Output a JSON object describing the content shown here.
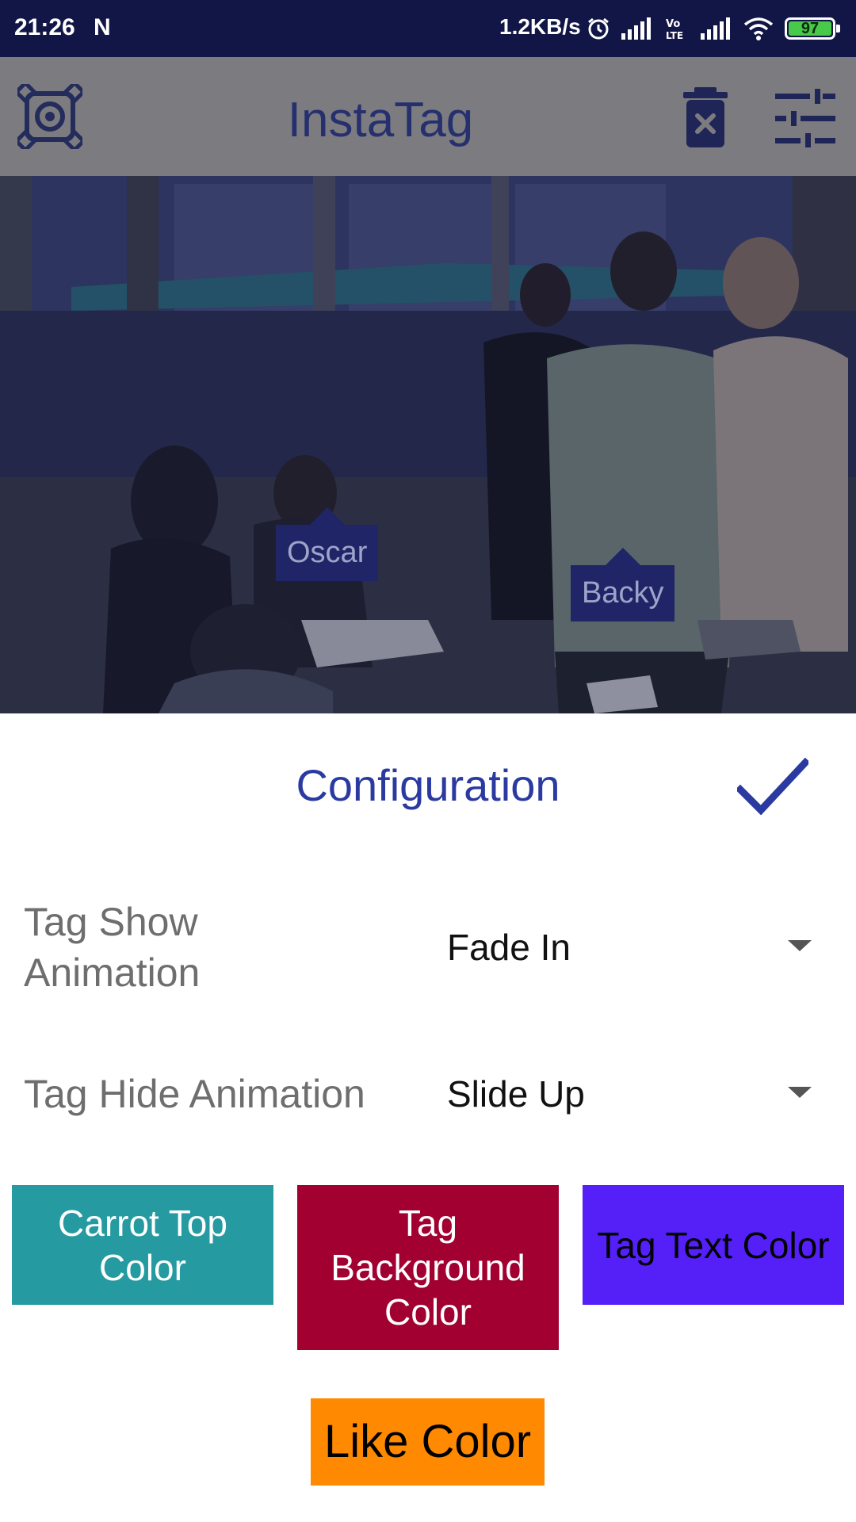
{
  "status_bar": {
    "time": "21:26",
    "carrier_glyph": "N",
    "speed": "1.2KB/s",
    "battery": "97",
    "icons": [
      "alarm-icon",
      "signal-icon",
      "volte-icon",
      "signal-icon",
      "wifi-icon",
      "battery-icon"
    ]
  },
  "app_bar": {
    "title": "InstaTag",
    "icons": [
      "app-logo-icon",
      "trash-icon",
      "tune-icon"
    ],
    "background": "#7c7c80"
  },
  "photo": {
    "tags": [
      {
        "label": "Oscar"
      },
      {
        "label": "Backy"
      }
    ]
  },
  "config": {
    "title": "Configuration",
    "rows": [
      {
        "label": "Tag Show Animation",
        "value": "Fade In"
      },
      {
        "label": "Tag Hide Animation",
        "value": "Slide Up"
      }
    ],
    "color_buttons": [
      {
        "label": "Carrot Top Color",
        "color": "#259aa0",
        "text_color": "#ffffff"
      },
      {
        "label": "Tag Background Color",
        "color": "#a10031",
        "text_color": "#ffffff"
      },
      {
        "label": "Tag Text Color",
        "color": "#5520f8",
        "text_color": "#000000"
      },
      {
        "label": "Like Color",
        "color": "#ff8900",
        "text_color": "#000000"
      }
    ],
    "accent": "#2b3aa0"
  }
}
